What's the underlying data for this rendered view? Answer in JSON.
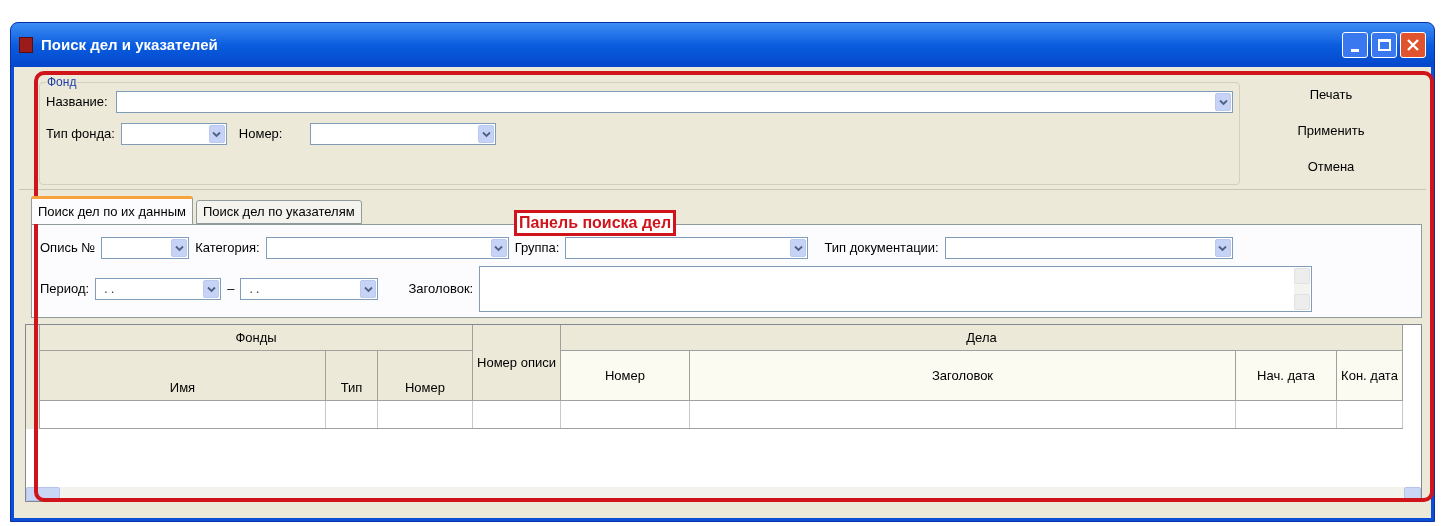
{
  "window": {
    "title": "Поиск дел и указателей"
  },
  "fond": {
    "legend": "Фонд",
    "name_label": "Название:",
    "type_label": "Тип фонда:",
    "number_label": "Номер:"
  },
  "actions": [
    "Печать",
    "Применить",
    "Отмена"
  ],
  "tabs": [
    {
      "label": "Поиск дел по их данным",
      "selected": true
    },
    {
      "label": "Поиск дел по указателям",
      "selected": false
    }
  ],
  "annotation": {
    "label": "Панель поиска дел"
  },
  "filters_row1": [
    {
      "label": "Опись №"
    },
    {
      "label": "Категория:"
    },
    {
      "label": "Группа:"
    },
    {
      "label": "Тип документации:"
    }
  ],
  "period": {
    "label": "Период:",
    "from": ". .",
    "dash": "–",
    "to": ". ."
  },
  "title_filter": {
    "label": "Заголовок:"
  },
  "table": {
    "groups": [
      {
        "label": "Фонды",
        "columns": [
          "Имя",
          "Тип",
          "Номер"
        ]
      },
      {
        "label": "Номер описи"
      },
      {
        "label": "Дела",
        "columns": [
          "Номер",
          "Заголовок",
          "Нач. дата",
          "Кон. дата"
        ]
      }
    ]
  }
}
